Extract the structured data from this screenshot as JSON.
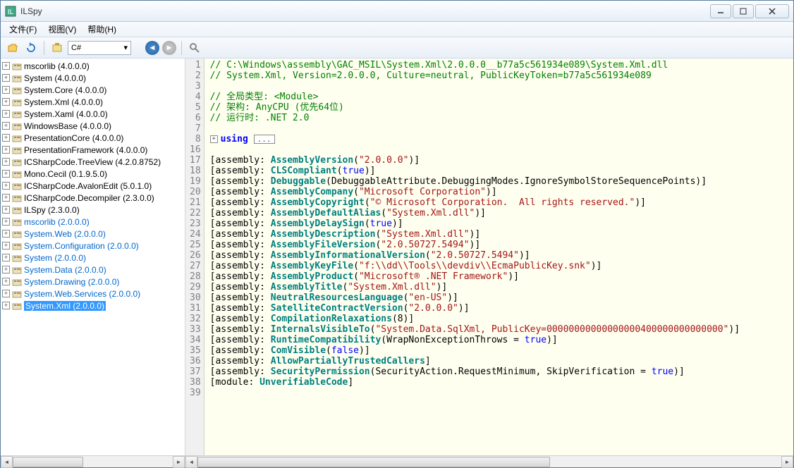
{
  "title": "ILSpy",
  "menu": {
    "file": "文件(F)",
    "view": "视图(V)",
    "help": "帮助(H)"
  },
  "toolbar": {
    "language": "C#"
  },
  "tree": [
    {
      "label": "mscorlib (4.0.0.0)",
      "link": false
    },
    {
      "label": "System (4.0.0.0)",
      "link": false
    },
    {
      "label": "System.Core (4.0.0.0)",
      "link": false
    },
    {
      "label": "System.Xml (4.0.0.0)",
      "link": false
    },
    {
      "label": "System.Xaml (4.0.0.0)",
      "link": false
    },
    {
      "label": "WindowsBase (4.0.0.0)",
      "link": false
    },
    {
      "label": "PresentationCore (4.0.0.0)",
      "link": false
    },
    {
      "label": "PresentationFramework (4.0.0.0)",
      "link": false
    },
    {
      "label": "ICSharpCode.TreeView (4.2.0.8752)",
      "link": false
    },
    {
      "label": "Mono.Cecil (0.1.9.5.0)",
      "link": false
    },
    {
      "label": "ICSharpCode.AvalonEdit (5.0.1.0)",
      "link": false
    },
    {
      "label": "ICSharpCode.Decompiler (2.3.0.0)",
      "link": false
    },
    {
      "label": "ILSpy (2.3.0.0)",
      "link": false
    },
    {
      "label": "mscorlib (2.0.0.0)",
      "link": true
    },
    {
      "label": "System.Web (2.0.0.0)",
      "link": true
    },
    {
      "label": "System.Configuration (2.0.0.0)",
      "link": true
    },
    {
      "label": "System (2.0.0.0)",
      "link": true
    },
    {
      "label": "System.Data (2.0.0.0)",
      "link": true
    },
    {
      "label": "System.Drawing (2.0.0.0)",
      "link": true
    },
    {
      "label": "System.Web.Services (2.0.0.0)",
      "link": true
    },
    {
      "label": "System.Xml (2.0.0.0)",
      "link": true,
      "selected": true
    }
  ],
  "code": {
    "lines": [
      {
        "n": 1,
        "type": "comment",
        "text": "// C:\\Windows\\assembly\\GAC_MSIL\\System.Xml\\2.0.0.0__b77a5c561934e089\\System.Xml.dll"
      },
      {
        "n": 2,
        "type": "comment",
        "text": "// System.Xml, Version=2.0.0.0, Culture=neutral, PublicKeyToken=b77a5c561934e089"
      },
      {
        "n": 3,
        "type": "blank",
        "text": ""
      },
      {
        "n": 4,
        "type": "comment",
        "text": "// 全局类型: <Module>"
      },
      {
        "n": 5,
        "type": "comment",
        "text": "// 架构: AnyCPU (优先64位)"
      },
      {
        "n": 6,
        "type": "comment",
        "text": "// 运行时: .NET 2.0"
      },
      {
        "n": 7,
        "type": "blank",
        "text": ""
      },
      {
        "n": 8,
        "type": "using"
      },
      {
        "n": 16,
        "type": "blank",
        "text": ""
      },
      {
        "n": 17,
        "type": "attr",
        "name": "AssemblyVersion",
        "arg_str": "\"2.0.0.0\""
      },
      {
        "n": 18,
        "type": "attr",
        "name": "CLSCompliant",
        "arg_bool": "true"
      },
      {
        "n": 19,
        "type": "attr",
        "name": "Debuggable",
        "arg_plain": "DebuggableAttribute.DebuggingModes.IgnoreSymbolStoreSequencePoints"
      },
      {
        "n": 20,
        "type": "attr",
        "name": "AssemblyCompany",
        "arg_str": "\"Microsoft Corporation\""
      },
      {
        "n": 21,
        "type": "attr",
        "name": "AssemblyCopyright",
        "arg_str": "\"© Microsoft Corporation.  All rights reserved.\""
      },
      {
        "n": 22,
        "type": "attr",
        "name": "AssemblyDefaultAlias",
        "arg_str": "\"System.Xml.dll\""
      },
      {
        "n": 23,
        "type": "attr",
        "name": "AssemblyDelaySign",
        "arg_bool": "true"
      },
      {
        "n": 24,
        "type": "attr",
        "name": "AssemblyDescription",
        "arg_str": "\"System.Xml.dll\""
      },
      {
        "n": 25,
        "type": "attr",
        "name": "AssemblyFileVersion",
        "arg_str": "\"2.0.50727.5494\""
      },
      {
        "n": 26,
        "type": "attr",
        "name": "AssemblyInformationalVersion",
        "arg_str": "\"2.0.50727.5494\""
      },
      {
        "n": 27,
        "type": "attr",
        "name": "AssemblyKeyFile",
        "arg_str": "\"f:\\\\dd\\\\Tools\\\\devdiv\\\\EcmaPublicKey.snk\""
      },
      {
        "n": 28,
        "type": "attr",
        "name": "AssemblyProduct",
        "arg_str": "\"Microsoft® .NET Framework\""
      },
      {
        "n": 29,
        "type": "attr",
        "name": "AssemblyTitle",
        "arg_str": "\"System.Xml.dll\""
      },
      {
        "n": 30,
        "type": "attr",
        "name": "NeutralResourcesLanguage",
        "arg_str": "\"en-US\""
      },
      {
        "n": 31,
        "type": "attr",
        "name": "SatelliteContractVersion",
        "arg_str": "\"2.0.0.0\""
      },
      {
        "n": 32,
        "type": "attr",
        "name": "CompilationRelaxations",
        "arg_plain": "8"
      },
      {
        "n": 33,
        "type": "attr",
        "name": "InternalsVisibleTo",
        "arg_str": "\"System.Data.SqlXml, PublicKey=00000000000000000400000000000000\""
      },
      {
        "n": 34,
        "type": "attr",
        "name": "RuntimeCompatibility",
        "arg_expr_pre": "WrapNonExceptionThrows = ",
        "arg_bool": "true"
      },
      {
        "n": 35,
        "type": "attr",
        "name": "ComVisible",
        "arg_bool": "false"
      },
      {
        "n": 36,
        "type": "attr_bare",
        "name": "AllowPartiallyTrustedCallers"
      },
      {
        "n": 37,
        "type": "attr",
        "name": "SecurityPermission",
        "arg_expr_pre": "SecurityAction.RequestMinimum, SkipVerification = ",
        "arg_bool": "true"
      },
      {
        "n": 38,
        "type": "module_attr",
        "name": "UnverifiableCode"
      },
      {
        "n": 39,
        "type": "blank",
        "text": ""
      }
    ]
  }
}
